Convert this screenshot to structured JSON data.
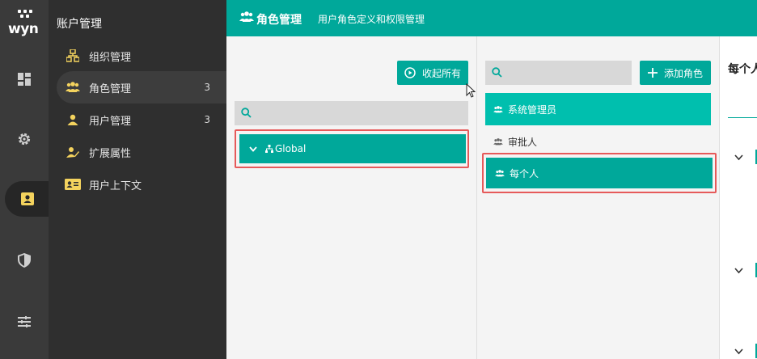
{
  "app": {
    "logo_text": "wyn",
    "section_title": "账户管理"
  },
  "rail": {
    "items": [
      {
        "icon": "dashboard-icon"
      },
      {
        "icon": "gear-icon"
      },
      {
        "icon": "user-card-icon",
        "active": true
      },
      {
        "icon": "shield-icon"
      },
      {
        "icon": "sliders-icon"
      }
    ]
  },
  "subnav": {
    "items": [
      {
        "label": "组织管理",
        "icon": "org-tree-icon",
        "count": ""
      },
      {
        "label": "角色管理",
        "icon": "role-group-icon",
        "count": "3",
        "active": true
      },
      {
        "label": "用户管理",
        "icon": "user-icon",
        "count": "3"
      },
      {
        "label": "扩展属性",
        "icon": "user-edit-icon",
        "count": ""
      },
      {
        "label": "用户上下文",
        "icon": "id-card-icon",
        "count": ""
      }
    ]
  },
  "header": {
    "title": "角色管理",
    "description": "用户角色定义和权限管理"
  },
  "org_tree": {
    "collapse_all_label": "收起所有",
    "search_placeholder": "",
    "root_node": "Global"
  },
  "roles": {
    "search_placeholder": "",
    "add_role_label": "添加角色",
    "items": [
      {
        "label": "系统管理员",
        "style": "primary"
      },
      {
        "label": "审批人",
        "style": "plain"
      },
      {
        "label": "每个人",
        "style": "selected"
      }
    ]
  },
  "detail": {
    "title": "每个人"
  },
  "colors": {
    "accent": "#00a89a",
    "accent_light": "#00bfae",
    "highlight_border": "#e65a5a",
    "rail_bg": "#3a3a3a",
    "subnav_bg": "#2f2f2f"
  }
}
